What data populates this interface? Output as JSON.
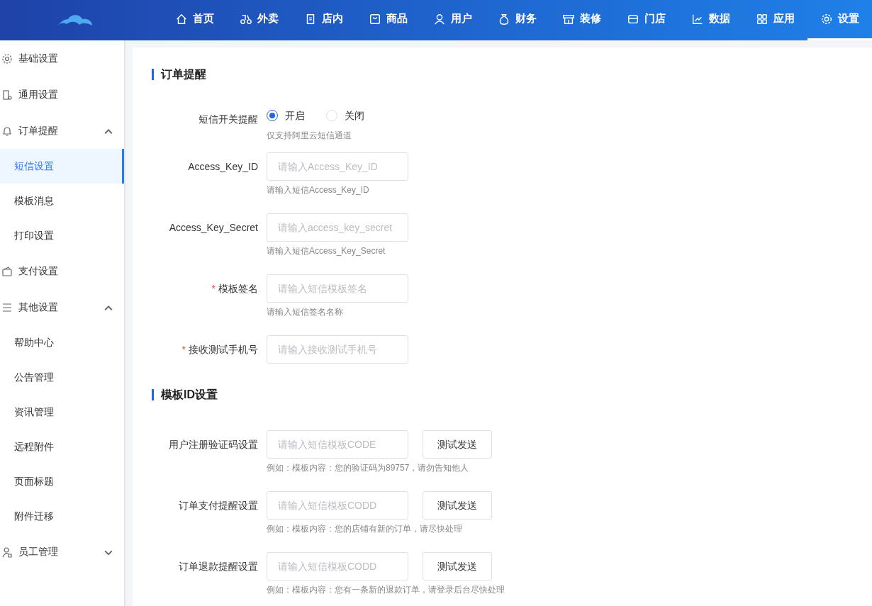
{
  "nav": [
    {
      "label": "首页",
      "selected": false
    },
    {
      "label": "外卖",
      "selected": false
    },
    {
      "label": "店内",
      "selected": false
    },
    {
      "label": "商品",
      "selected": false
    },
    {
      "label": "用户",
      "selected": false
    },
    {
      "label": "财务",
      "selected": false
    },
    {
      "label": "装修",
      "selected": false
    },
    {
      "label": "门店",
      "selected": false
    },
    {
      "label": "数据",
      "selected": false
    },
    {
      "label": "应用",
      "selected": false
    },
    {
      "label": "设置",
      "selected": true
    }
  ],
  "sidebar": {
    "items": [
      {
        "label": "基础设置"
      },
      {
        "label": "通用设置"
      },
      {
        "label": "订单提醒",
        "expanded": true,
        "children": [
          {
            "label": "短信设置",
            "selected": true
          },
          {
            "label": "模板消息",
            "selected": false
          },
          {
            "label": "打印设置",
            "selected": false
          }
        ]
      },
      {
        "label": "支付设置"
      },
      {
        "label": "其他设置",
        "expanded": true,
        "children": [
          {
            "label": "帮助中心",
            "selected": false
          },
          {
            "label": "公告管理",
            "selected": false
          },
          {
            "label": "资讯管理",
            "selected": false
          },
          {
            "label": "远程附件",
            "selected": false
          },
          {
            "label": "页面标题",
            "selected": false
          },
          {
            "label": "附件迁移",
            "selected": false
          }
        ]
      },
      {
        "label": "员工管理",
        "expanded": false
      }
    ]
  },
  "sections": [
    {
      "title": "订单提醒",
      "rows": [
        {
          "kind": "radio",
          "label": "短信开关提醒",
          "options": [
            {
              "label": "开启",
              "selected": true
            },
            {
              "label": "关闭",
              "selected": false
            }
          ],
          "hint": "仅支持阿里云短信通道"
        },
        {
          "kind": "input",
          "label": "Access_Key_ID",
          "placeholder": "请输入Access_Key_ID",
          "hint": "请输入短信Access_Key_ID"
        },
        {
          "kind": "input",
          "label": "Access_Key_Secret",
          "placeholder": "请输入access_key_secret",
          "hint": "请输入短信Access_Key_Secret"
        },
        {
          "kind": "input",
          "label": "模板签名",
          "required_mark": "*",
          "placeholder": "请输入短信模板签名",
          "hint": "请输入短信签名名称"
        },
        {
          "kind": "input",
          "label": "接收测试手机号",
          "required_mark": "*",
          "placeholder": "请输入接收测试手机号"
        }
      ]
    },
    {
      "title": "模板ID设置",
      "rows": [
        {
          "kind": "input",
          "label": "用户注册验证码设置",
          "placeholder": "请输入短信模板CODE",
          "button": "测试发送",
          "hint": "例如：模板内容：您的验证码为89757，请勿告知他人"
        },
        {
          "kind": "input",
          "label": "订单支付提醒设置",
          "placeholder": "请输入短信模板CODD",
          "button": "测试发送",
          "hint": "例如：模板内容：您的店铺有新的订单，请尽快处理"
        },
        {
          "kind": "input",
          "label": "订单退款提醒设置",
          "placeholder": "请输入短信模板CODD",
          "button": "测试发送",
          "hint": "例如：模板内容：您有一条新的退款订单，请登录后台尽快处理"
        }
      ]
    }
  ]
}
